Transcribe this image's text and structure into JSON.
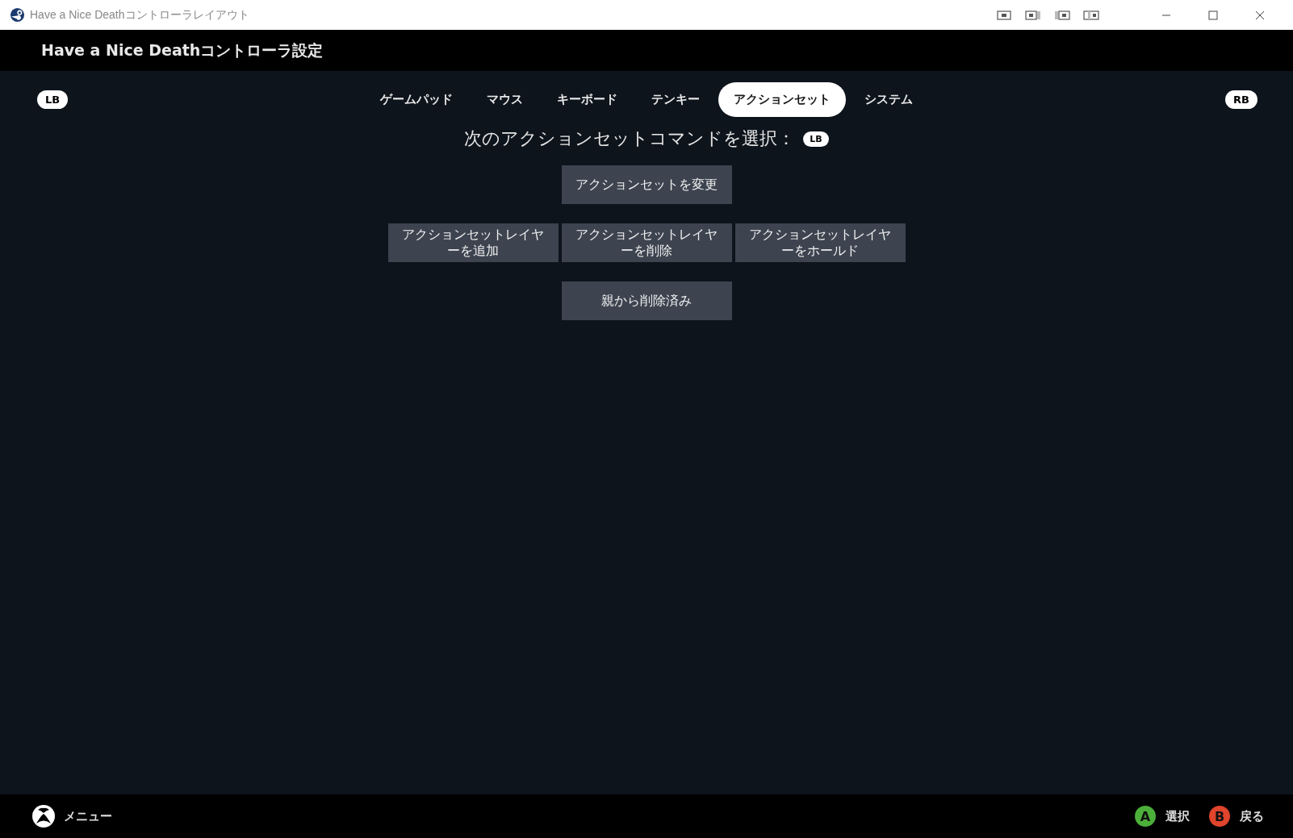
{
  "window": {
    "title": "Have a Nice Deathコントローラレイアウト"
  },
  "header": {
    "title": "Have a Nice Deathコントローラ設定"
  },
  "bumpers": {
    "left": "LB",
    "right": "RB"
  },
  "tabs": [
    {
      "label": "ゲームパッド",
      "selected": false
    },
    {
      "label": "マウス",
      "selected": false
    },
    {
      "label": "キーボード",
      "selected": false
    },
    {
      "label": "テンキー",
      "selected": false
    },
    {
      "label": "アクションセット",
      "selected": true
    },
    {
      "label": "システム",
      "selected": false
    }
  ],
  "prompt": {
    "text": "次のアクションセットコマンドを選択：",
    "badge": "LB"
  },
  "command_rows": [
    [
      "アクションセットを変更"
    ],
    [
      "アクションセットレイヤーを追加",
      "アクションセットレイヤーを削除",
      "アクションセットレイヤーをホールド"
    ],
    [
      "親から削除済み"
    ]
  ],
  "footer": {
    "menu": "メニュー",
    "actions": [
      {
        "key": "A",
        "label": "選択",
        "color": "#4caf3a"
      },
      {
        "key": "B",
        "label": "戻る",
        "color": "#e0442c"
      }
    ]
  }
}
